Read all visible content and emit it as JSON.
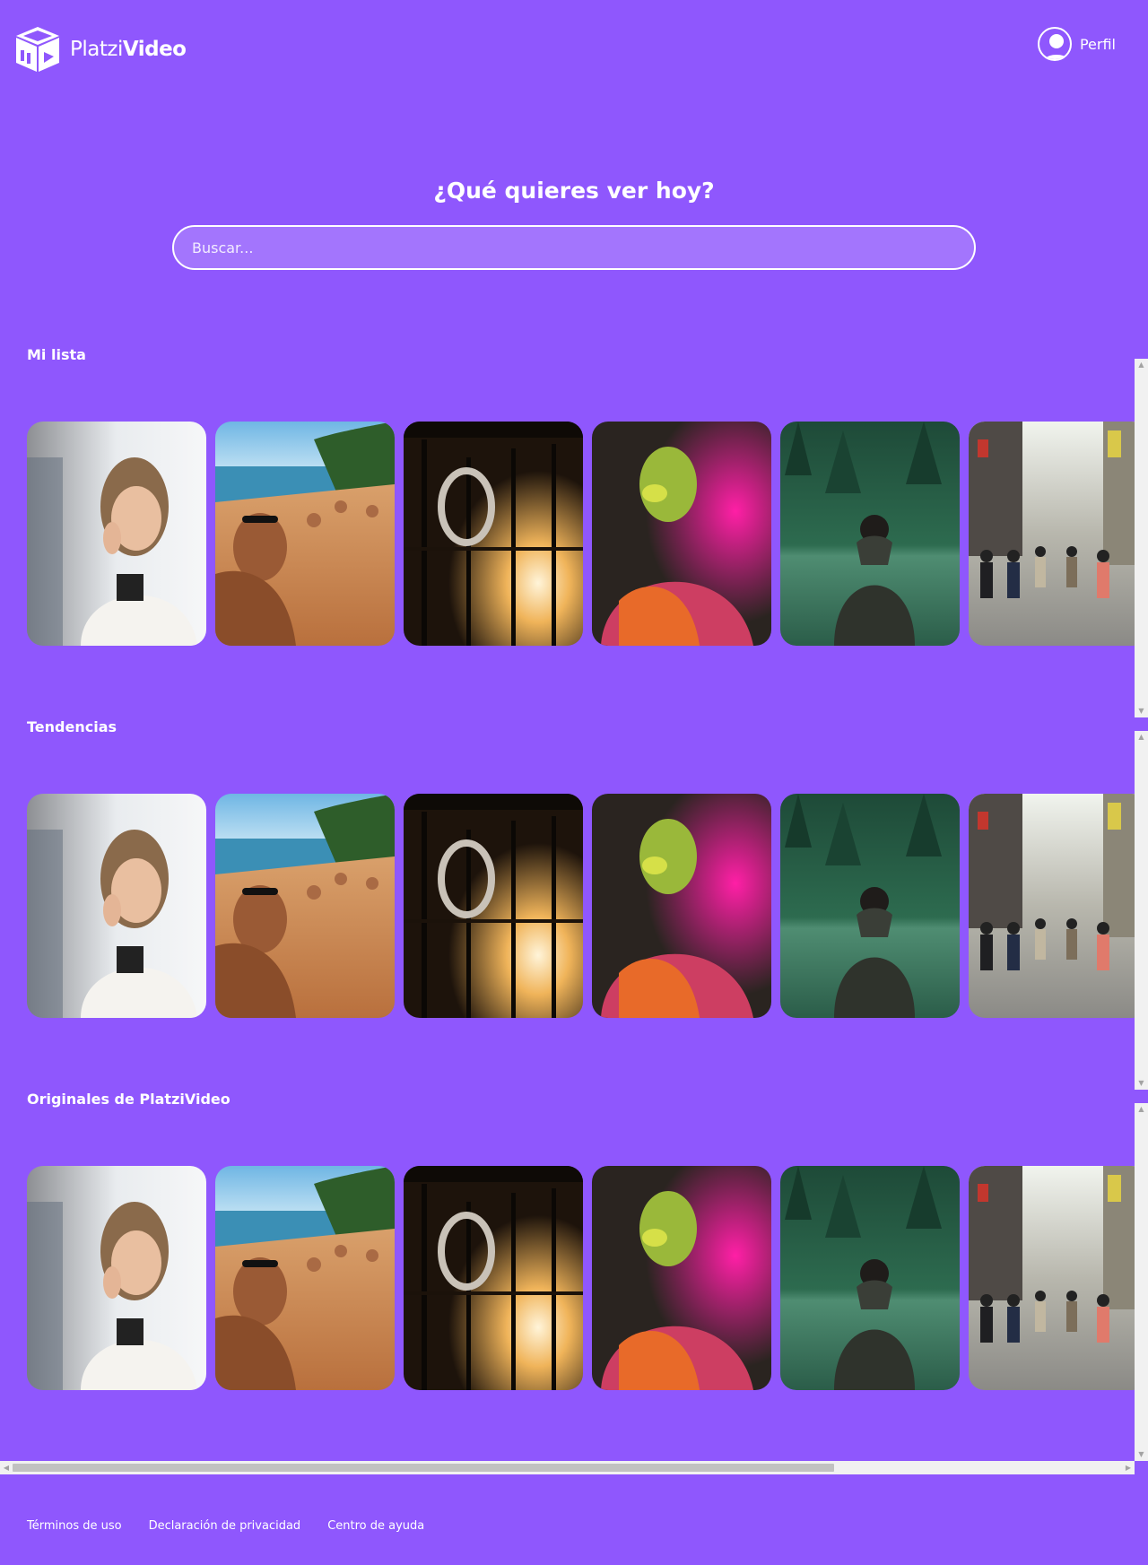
{
  "header": {
    "logo_light": "Platzi",
    "logo_bold": "Video",
    "profile_label": "Perfil"
  },
  "main": {
    "title": "¿Qué quieres ver hoy?",
    "search_placeholder": "Buscar..."
  },
  "categories": [
    {
      "title": "Mi lista"
    },
    {
      "title": "Tendencias"
    },
    {
      "title": "Originales de PlatziVideo"
    }
  ],
  "cards": [
    {
      "icon": "woman-on-phone-photo"
    },
    {
      "icon": "beach-selfie-photo"
    },
    {
      "icon": "backlit-interior-photo"
    },
    {
      "icon": "color-powder-man-photo"
    },
    {
      "icon": "man-at-lake-photo"
    },
    {
      "icon": "city-street-crowd-photo"
    }
  ],
  "footer": {
    "links": [
      "Términos de uso",
      "Declaración de privacidad",
      "Centro de ayuda"
    ]
  },
  "colors": {
    "background": "#8f57fd",
    "text": "#ffffff",
    "scroll_track": "#f1f1f1",
    "scroll_thumb": "#c1c1c1"
  }
}
